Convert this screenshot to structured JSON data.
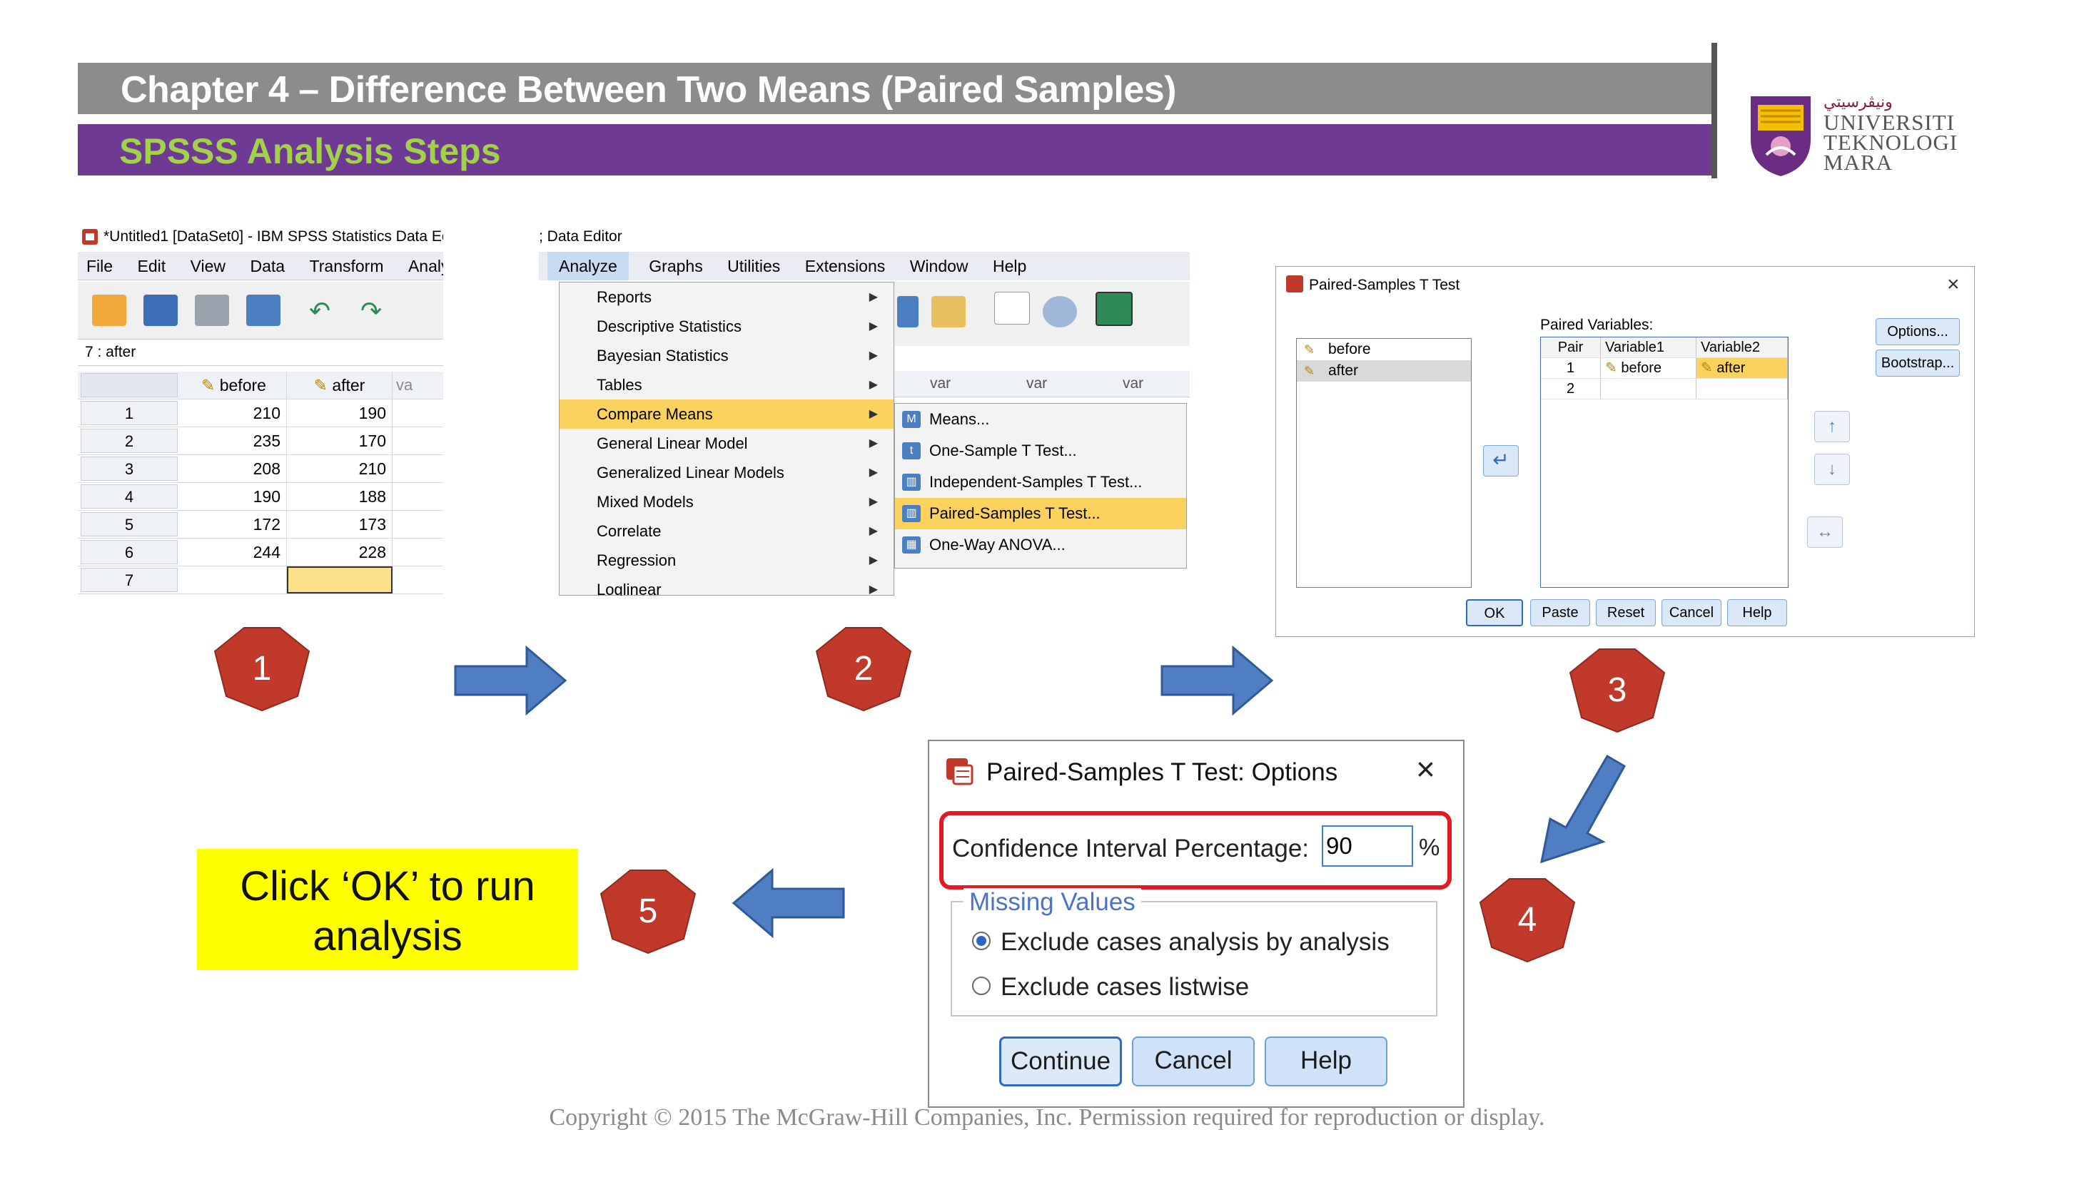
{
  "header": {
    "title": "Chapter 4 – Difference Between Two Means (Paired Samples)",
    "subtitle": "SPSSS Analysis Steps",
    "title_bar_color": "#8c8c8c",
    "subtitle_bar_color": "#6e3a94",
    "subtitle_text_color": "#a3d14a"
  },
  "logo": {
    "jawi": "ونيڤرسيتي",
    "line1": "UNIVERSITI",
    "line2": "TEKNOLOGI",
    "line3": "MARA",
    "icon": "uitm-emblem-icon"
  },
  "step1": {
    "window_title": "*Untitled1 [DataSet0] - IBM SPSS Statistics Data Ec",
    "menu": [
      "File",
      "Edit",
      "View",
      "Data",
      "Transform",
      "Analy"
    ],
    "cell_ref": "7 : after",
    "columns": [
      "before",
      "after",
      "va"
    ],
    "rows": [
      {
        "n": "1",
        "before": "210",
        "after": "190"
      },
      {
        "n": "2",
        "before": "235",
        "after": "170"
      },
      {
        "n": "3",
        "before": "208",
        "after": "210"
      },
      {
        "n": "4",
        "before": "190",
        "after": "188"
      },
      {
        "n": "5",
        "before": "172",
        "after": "173"
      },
      {
        "n": "6",
        "before": "244",
        "after": "228"
      },
      {
        "n": "7",
        "before": "",
        "after": ""
      }
    ]
  },
  "step2": {
    "window_title": "; Data Editor",
    "menu": [
      "Analyze",
      "Graphs",
      "Utilities",
      "Extensions",
      "Window",
      "Help"
    ],
    "dropdown": [
      "Reports",
      "Descriptive Statistics",
      "Bayesian Statistics",
      "Tables",
      "Compare Means",
      "General Linear Model",
      "Generalized Linear Models",
      "Mixed Models",
      "Correlate",
      "Regression",
      "Loglinear"
    ],
    "submenu": [
      "Means...",
      "One-Sample T Test...",
      "Independent-Samples T Test...",
      "Paired-Samples T Test...",
      "One-Way ANOVA..."
    ],
    "var_headers": [
      "var",
      "var",
      "var"
    ]
  },
  "step3": {
    "window_title": "Paired-Samples T Test",
    "source_vars": [
      "before",
      "after"
    ],
    "paired_label": "Paired Variables:",
    "table_headers": [
      "Pair",
      "Variable1",
      "Variable2"
    ],
    "pairs": [
      {
        "pair": "1",
        "v1": "before",
        "v2": "after"
      },
      {
        "pair": "2",
        "v1": "",
        "v2": ""
      }
    ],
    "side_buttons": [
      "Options...",
      "Bootstrap..."
    ],
    "bottom_buttons": [
      "OK",
      "Paste",
      "Reset",
      "Cancel",
      "Help"
    ]
  },
  "steps": [
    "1",
    "2",
    "3",
    "4",
    "5"
  ],
  "options_dialog": {
    "title": "Paired-Samples T Test: Options",
    "ci_label": "Confidence Interval Percentage:",
    "ci_value": "90",
    "ci_unit": "%",
    "missing_label": "Missing Values",
    "radio1": "Exclude cases analysis by analysis",
    "radio2": "Exclude cases listwise",
    "buttons": [
      "Continue",
      "Cancel",
      "Help"
    ],
    "highlight_color": "#e01b24"
  },
  "callout": {
    "line1": "Click ‘OK’ to run",
    "line2": "analysis",
    "bg": "#ffff00"
  },
  "step_marker_color": "#c0392b",
  "arrow_color": "#4f7ec2",
  "copyright": "Copyright © 2015 The McGraw-Hill Companies, Inc.  Permission required for reproduction or display."
}
